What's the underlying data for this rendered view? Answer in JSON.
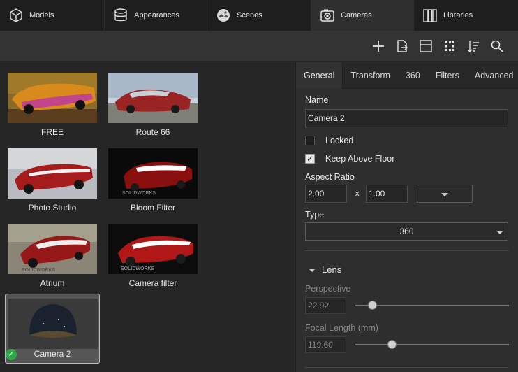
{
  "tabs": [
    {
      "label": "Models",
      "icon": "cube-icon"
    },
    {
      "label": "Appearances",
      "icon": "database-cylinder-icon"
    },
    {
      "label": "Scenes",
      "icon": "scene-sphere-icon"
    },
    {
      "label": "Cameras",
      "icon": "camera-icon",
      "active": true
    },
    {
      "label": "Libraries",
      "icon": "books-icon"
    }
  ],
  "toolbar": [
    "add-icon",
    "export-icon",
    "split-view-icon",
    "grid-view-icon",
    "sort-icon",
    "search-icon"
  ],
  "cameras": [
    {
      "label": "FREE"
    },
    {
      "label": "Route 66"
    },
    {
      "label": "Photo Studio"
    },
    {
      "label": "Bloom Filter"
    },
    {
      "label": "Atrium"
    },
    {
      "label": "Camera filter"
    },
    {
      "label": "Camera 2",
      "selected": true
    }
  ],
  "thumb_watermark": "SOLIDWORKS",
  "panel": {
    "tabs": [
      "General",
      "Transform",
      "360",
      "Filters",
      "Advanced"
    ],
    "name_label": "Name",
    "name_value": "Camera 2",
    "locked_label": "Locked",
    "locked": false,
    "keep_above_label": "Keep Above Floor",
    "keep_above": true,
    "aspect_label": "Aspect Ratio",
    "aspect_w": "2.00",
    "aspect_x": "x",
    "aspect_h": "1.00",
    "type_label": "Type",
    "type_value": "360",
    "lens_label": "Lens",
    "perspective_label": "Perspective",
    "perspective_value": "22.92",
    "perspective_level": 0.11,
    "focal_label": "Focal Length (mm)",
    "focal_value": "119.60",
    "focal_level": 0.24
  },
  "colors": {
    "check": "#2ea84a",
    "tab_active": "#2f2f2f",
    "panel": "#2e2e2e"
  }
}
